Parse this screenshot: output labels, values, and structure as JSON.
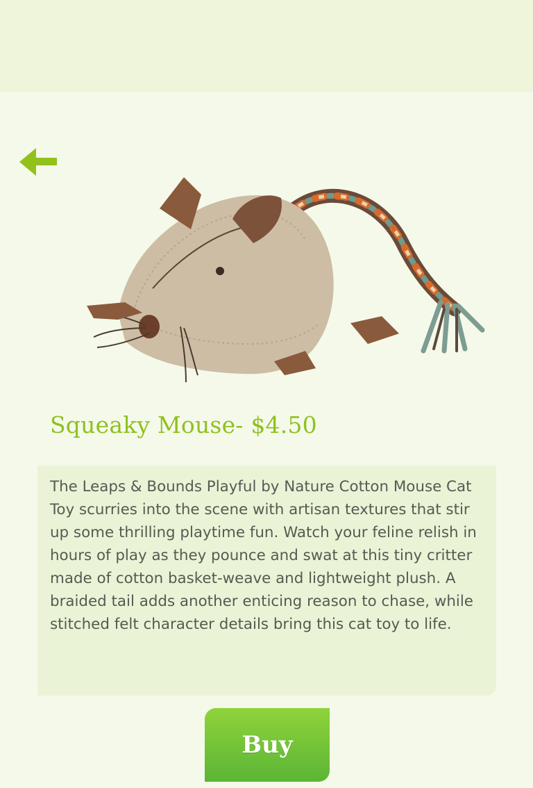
{
  "header": {
    "color": "#eef5da"
  },
  "nav": {
    "back_icon": "arrow-left-icon",
    "accent": "#93c11c"
  },
  "product": {
    "title": "Squeaky Mouse- $4.50",
    "image_label": "cotton mouse cat toy with braided tail",
    "description": "The Leaps & Bounds Playful by Nature Cotton Mouse Cat Toy scurries into the scene with artisan textures that stir up some thrilling playtime fun. Watch your feline relish in hours of play as they pounce and swat at this tiny critter made of cotton basket-weave and lightweight plush. A braided tail adds another enticing reason to chase, while stitched felt character details bring this cat toy to life."
  },
  "actions": {
    "buy_label": "Buy",
    "buy_color": "#6cbf35"
  }
}
